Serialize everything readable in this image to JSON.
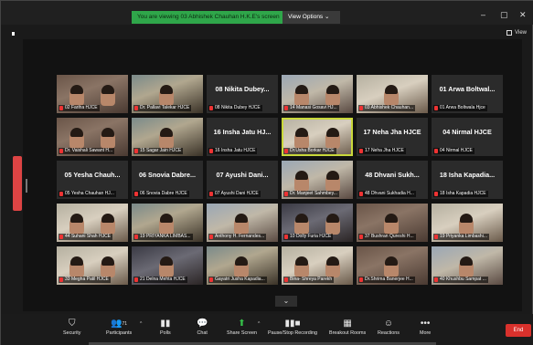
{
  "topbar": {
    "banner_text": "You are viewing 03 Abhishek Chauhan H.K.E's screen",
    "view_options": "View Options ⌄",
    "minimize": "–",
    "maximize": "▢",
    "close": "✕"
  },
  "view_label": "View",
  "participants_grid": [
    {
      "label": "02 Fariha HJCE",
      "big": "",
      "photo": "p1"
    },
    {
      "label": "Dr. Pallavi Talekar HJCE",
      "big": "",
      "photo": "p2"
    },
    {
      "label": "08 Nikita Dubey HJCE",
      "big": "08 Nikita Dubey...",
      "photo": ""
    },
    {
      "label": "14 Manasi Gosavi HJ...",
      "big": "",
      "photo": "p3"
    },
    {
      "label": "03 Abhishek Chauhan...",
      "big": "",
      "photo": "p4"
    },
    {
      "label": "01 Arwa Boltwala Hjce",
      "big": "01 Arwa Boltwal...",
      "photo": ""
    },
    {
      "label": "Dr. Vaishali Sawant H...",
      "big": "",
      "photo": "p1"
    },
    {
      "label": "15 Sagar Jain HJCE",
      "big": "",
      "photo": "p2"
    },
    {
      "label": "16 Insha Jatu HJCE",
      "big": "16 Insha Jatu HJ...",
      "photo": ""
    },
    {
      "label": "Dr.Usha Borkar HJCE",
      "big": "",
      "photo": "p4",
      "active": true
    },
    {
      "label": "17 Neha Jha HJCE",
      "big": "17 Neha Jha HJCE",
      "photo": ""
    },
    {
      "label": "04 Nirmal HJCE",
      "big": "04 Nirmal HJCE",
      "photo": ""
    },
    {
      "label": "05 Yesha Chauhan HJ...",
      "big": "05 Yesha Chauh...",
      "photo": ""
    },
    {
      "label": "06 Snovia Dabre HJCE",
      "big": "06 Snovia Dabre...",
      "photo": ""
    },
    {
      "label": "07 Ayushi Dani HJCE",
      "big": "07 Ayushi Dani...",
      "photo": ""
    },
    {
      "label": "Dr. Manjeet Sahmbey...",
      "big": "",
      "photo": "p3"
    },
    {
      "label": "48 Dhvani Sukhadia H...",
      "big": "48 Dhvani Sukh...",
      "photo": ""
    },
    {
      "label": "18 Isha Kapadia HJCE",
      "big": "18 Isha Kapadia...",
      "photo": ""
    },
    {
      "label": "44 Suhani Shah HJCE",
      "big": "",
      "photo": "p4"
    },
    {
      "label": "19 PRIYANKA LIMBAS...",
      "big": "",
      "photo": "p2"
    },
    {
      "label": "Anthony H. Fernandes...",
      "big": "",
      "photo": "p3"
    },
    {
      "label": "10 Dolly Furia HJCE",
      "big": "",
      "photo": "p5"
    },
    {
      "label": "37 Bushran Qureshi H...",
      "big": "",
      "photo": "p1"
    },
    {
      "label": "19 Priyanka Limbashi...",
      "big": "",
      "photo": "p4"
    },
    {
      "label": "33 Megha Patil HJCE",
      "big": "",
      "photo": "p4"
    },
    {
      "label": "21 Delna Mehta HJCE",
      "big": "",
      "photo": "p5"
    },
    {
      "label": "Gayatri Jusha Kapadia...",
      "big": "",
      "photo": "p2"
    },
    {
      "label": "Bina- Shreya Parekh",
      "big": "",
      "photo": "p4"
    },
    {
      "label": "Dr.Shrima Banerjee H...",
      "big": "",
      "photo": "p1"
    },
    {
      "label": "40 Khushbu Sampat ...",
      "big": "",
      "photo": "p3"
    }
  ],
  "toolbar": {
    "security": "Security",
    "participants": "Participants",
    "participants_count": "71",
    "polls": "Polls",
    "chat": "Chat",
    "share_screen": "Share Screen",
    "pause_recording": "Pause/Stop Recording",
    "breakout_rooms": "Breakout Rooms",
    "reactions": "Reactions",
    "more": "More",
    "end": "End"
  },
  "icons": {
    "security": "shield-icon",
    "participants": "people-icon",
    "polls": "bar-chart-icon",
    "chat": "chat-bubble-icon",
    "share_screen": "share-screen-icon",
    "recording": "pause-stop-icon",
    "breakout": "grid-icon",
    "reactions": "smiley-icon",
    "more": "ellipsis-icon"
  },
  "colors": {
    "banner_green": "#2fa64a",
    "active_speaker": "#c9d83a",
    "end_red": "#d9312c",
    "share_green": "#36c14a"
  }
}
